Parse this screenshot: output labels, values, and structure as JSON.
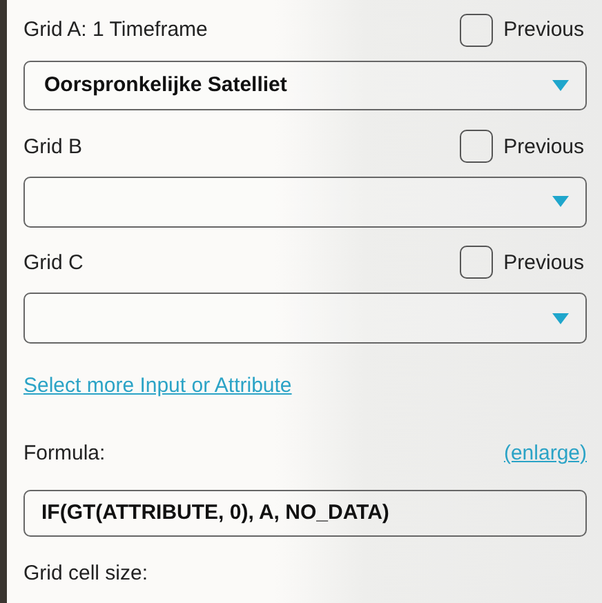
{
  "grids": [
    {
      "label": "Grid A: 1 Timeframe",
      "previous_label": "Previous",
      "previous_checked": false,
      "value": "Oorspronkelijke Satelliet"
    },
    {
      "label": "Grid B",
      "previous_label": "Previous",
      "previous_checked": false
    },
    {
      "label": "Grid C",
      "previous_label": "Previous",
      "previous_checked": false
    }
  ],
  "more_link": "Select more Input or Attribute",
  "formula": {
    "label": "Formula:",
    "enlarge": "(enlarge)",
    "value": "IF(GT(ATTRIBUTE, 0), A, NO_DATA)"
  },
  "cell_size_label": "Grid cell size:"
}
